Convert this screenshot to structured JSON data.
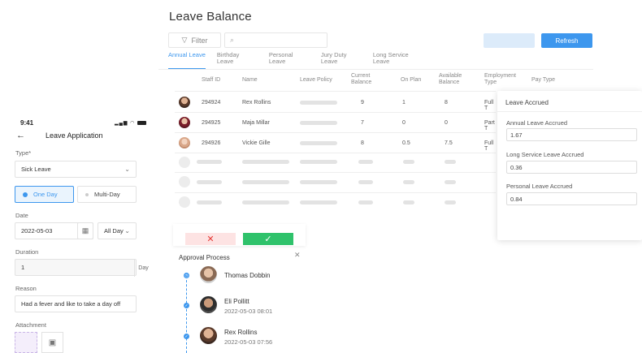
{
  "leave_balance": {
    "title": "Leave Balance",
    "filter_label": "Filter",
    "search_placeholder": "",
    "refresh_label": "Refresh",
    "tabs": [
      {
        "label": "Annual Leave",
        "active": true
      },
      {
        "label": "Birthday Leave"
      },
      {
        "label": "Personal Leave"
      },
      {
        "label": "Jury Duty Leave"
      },
      {
        "label": "Long Service Leave"
      }
    ],
    "columns": [
      "Staff ID",
      "Name",
      "Leave Policy",
      "Current Balance",
      "On Plan",
      "Available Balance",
      "Employment Type",
      "Pay Type"
    ],
    "rows": [
      {
        "staff_id": "294924",
        "name": "Rex Rollins",
        "current": "9",
        "on_plan": "1",
        "available": "8",
        "employment": "Full T"
      },
      {
        "staff_id": "294925",
        "name": "Maja Millar",
        "current": "7",
        "on_plan": "0",
        "available": "0",
        "employment": "Part T"
      },
      {
        "staff_id": "294926",
        "name": "Vickie Gille",
        "current": "8",
        "on_plan": "0.5",
        "available": "7.5",
        "employment": "Full T"
      }
    ]
  },
  "leave_accrued": {
    "title": "Leave Accrued",
    "annual_label": "Annual Leave Accrued",
    "annual_value": "1.67",
    "long_service_label": "Long Service Leave Accrued",
    "long_service_value": "0.36",
    "personal_label": "Personal Leave Accrued",
    "personal_value": "0.84"
  },
  "approval": {
    "title": "Approval Process",
    "steps": [
      {
        "name": "Thomas Dobbin",
        "date": ""
      },
      {
        "name": "Eli Pollitt",
        "date": "2022-05-03 08:01"
      },
      {
        "name": "Rex Rollins",
        "date": "2022-05-03 07:56"
      }
    ]
  },
  "mobile": {
    "time": "9:41",
    "title": "Leave Application",
    "type_label": "Type*",
    "type_value": "Sick Leave",
    "one_day": "One Day",
    "multi_day": "Multi-Day",
    "date_label": "Date",
    "date_value": "2022-05-03",
    "day_option": "All Day",
    "duration_label": "Duration",
    "duration_value": "1",
    "duration_unit": "Day",
    "reason_label": "Reason",
    "reason_value": "Had a fever and like to take a day off",
    "attachment_label": "Attachment"
  },
  "colors": {
    "accent": "#3d97ee",
    "approve": "#2fc26b",
    "reject": "#e53935"
  }
}
